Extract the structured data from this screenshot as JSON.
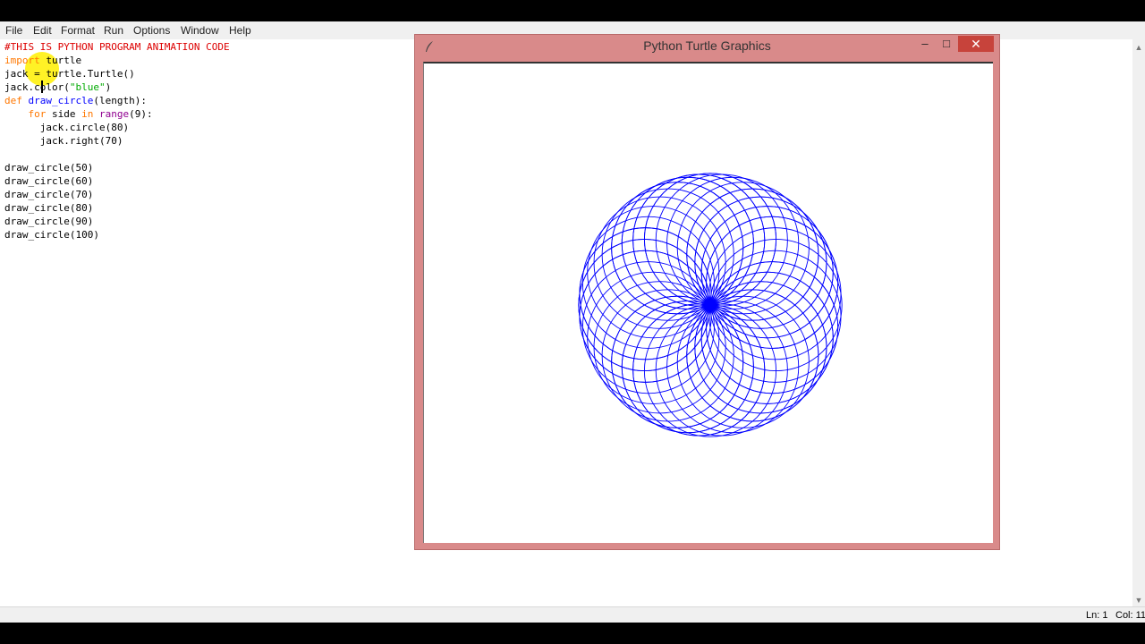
{
  "menu": {
    "items": [
      "File",
      "Edit",
      "Format",
      "Run",
      "Options",
      "Window",
      "Help"
    ]
  },
  "code": {
    "lines": [
      "#THIS IS PYTHON PROGRAM ANIMATION CODE",
      "import turtle",
      "jack = turtle.Turtle()",
      "jack.color(\"blue\")",
      "def draw_circle(length):",
      "    for side in range(9):",
      "      jack.circle(80)",
      "      jack.right(70)",
      "",
      "draw_circle(50)",
      "draw_circle(60)",
      "draw_circle(70)",
      "draw_circle(80)",
      "draw_circle(90)",
      "draw_circle(100)"
    ]
  },
  "status": {
    "ln": "Ln: 1",
    "col": "Col: 11"
  },
  "turtle_window": {
    "title": "Python Turtle Graphics",
    "minimize_glyph": "–",
    "maximize_glyph": "□",
    "close_glyph": "✕",
    "pen_color": "#0000ff",
    "circle_radius": 80,
    "circles_per_call": 9,
    "turn_angle": 70,
    "calls": 6
  },
  "colors": {
    "comment": "#dd0000",
    "keyword": "#ff7700",
    "string": "#00aa00",
    "definition": "#0000ff",
    "titlebar": "#d98a8a",
    "close_button": "#c7433b"
  }
}
